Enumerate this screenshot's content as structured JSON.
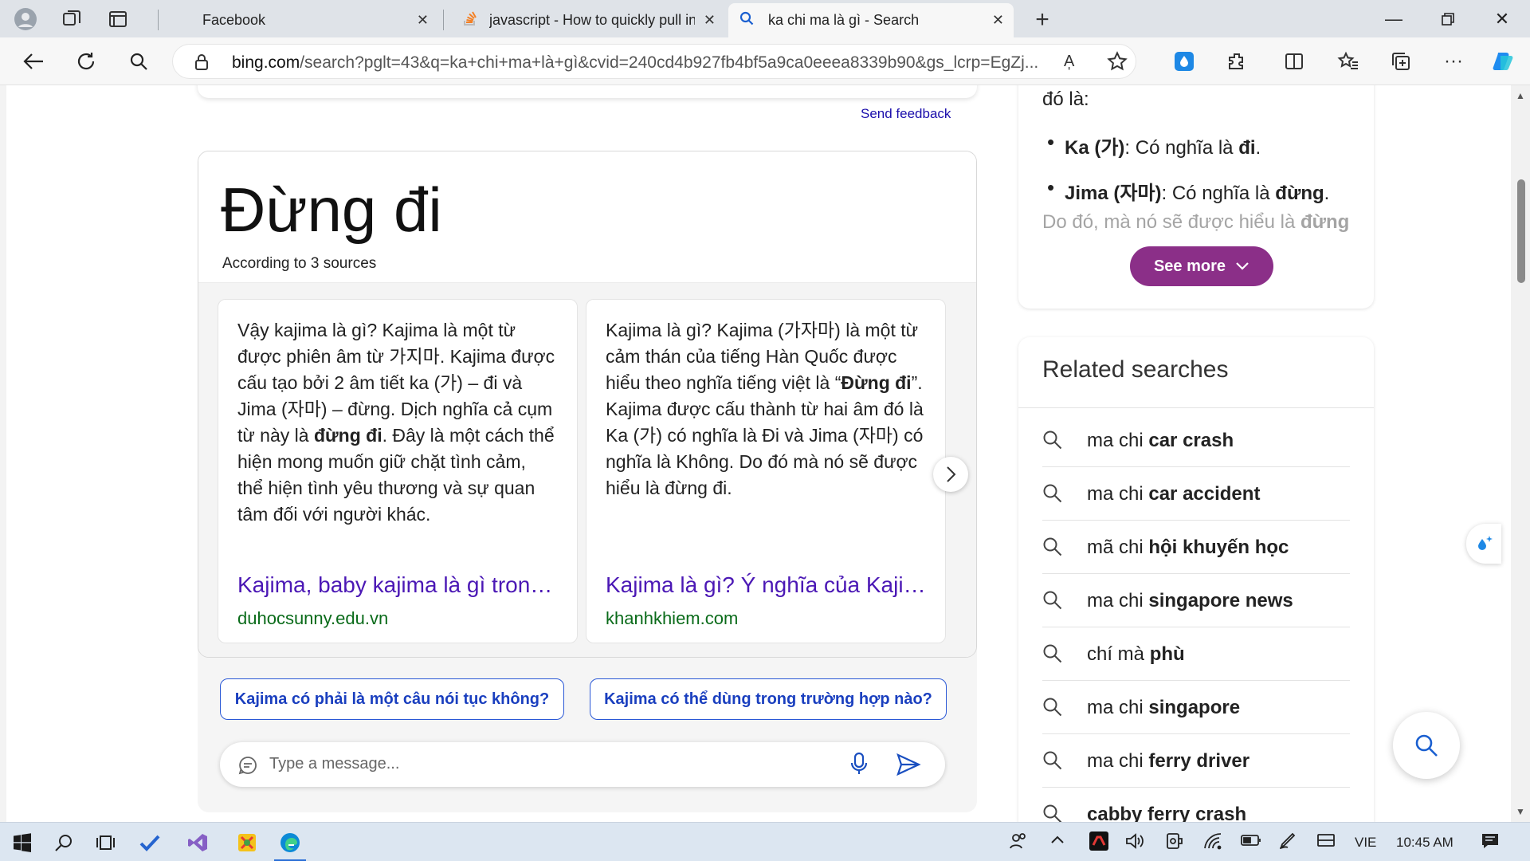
{
  "browser": {
    "tabs": [
      {
        "title": "Facebook",
        "active": false
      },
      {
        "title": "javascript - How to quickly pull in",
        "active": false
      },
      {
        "title": "ka chi ma là gì - Search",
        "active": true
      }
    ],
    "address": {
      "host": "bing.com",
      "path": "/search?pglt=43&q=ka+chi+ma+là+gì&cvid=240cd4b927fb4bf5a9ca0eeea8339b90&gs_lcrp=EgZj..."
    },
    "read_aloud_label": "A̩"
  },
  "page": {
    "send_feedback": "Send feedback",
    "answer": {
      "headline": "Đừng đi",
      "according": "According to 3 sources",
      "sources": [
        {
          "snippet_html": "Vậy kajima là gì? Kajima là một từ được phiên âm từ 가지마. Kajima được cấu tạo bởi 2 âm tiết ka (가) – đi và Jima (자마) – đừng. Dịch nghĩa cả cụm từ này là <b>đừng đi</b>. Đây là một cách thể hiện mong muốn giữ chặt tình cảm, thể hiện tình yêu thương và sự quan tâm đối với người khác.",
          "title": "Kajima, baby kajima là gì trong tiếng Hàn",
          "domain": "duhocsunny.edu.vn"
        },
        {
          "snippet_html": "Kajima là gì? Kajima (가자마) là một từ cảm thán của tiếng Hàn Quốc được hiểu theo nghĩa tiếng việt là “<b>Đừng đi</b>”. Kajima được cấu thành từ hai âm đó là Ka (가) có nghĩa là Đi và Jima (자마) có nghĩa là Không. Do đó mà nó sẽ được hiểu là đừng đi.",
          "title": "Kajima là gì? Ý nghĩa của Kajima",
          "domain": "khanhkhiem.com"
        }
      ]
    },
    "suggestions": [
      "Kajima có phải là một câu nói tục không?",
      "Kajima có thể dùng trong trường hợp nào?"
    ],
    "message_placeholder": "Type a message...",
    "right_panel": {
      "intro": "đó là:",
      "bullets": [
        {
          "term": "Ka (가)",
          "text": ": Có nghĩa là ",
          "bold": "đi",
          "end": "."
        },
        {
          "term": "Jima (자마)",
          "text": ": Có nghĩa là ",
          "bold": "đừng",
          "end": "."
        }
      ],
      "fade_text": "Do đó, mà nó sẽ được hiểu là ",
      "fade_bold": "đừng",
      "see_more": "See more"
    },
    "related": {
      "title": "Related searches",
      "items": [
        {
          "plain": "ma chi ",
          "bold": "car crash"
        },
        {
          "plain": "ma chi ",
          "bold": "car accident"
        },
        {
          "plain": "mã chi ",
          "bold": "hội khuyến học"
        },
        {
          "plain": "ma chi ",
          "bold": "singapore news"
        },
        {
          "plain": "chí mà ",
          "bold": "phù"
        },
        {
          "plain": "ma chi ",
          "bold": "singapore"
        },
        {
          "plain": "ma chi ",
          "bold": "ferry driver"
        },
        {
          "plain": "",
          "bold": "cabby ferry crash"
        }
      ]
    }
  },
  "taskbar": {
    "language": "VIE",
    "time": "10:45 AM"
  },
  "colors": {
    "link_title": "#4b18b5",
    "domain_green": "#0a6b1a",
    "see_more_bg": "#8b2f88",
    "suggest_blue": "#1a3fbf",
    "feedback_link": "#1a0dab"
  }
}
